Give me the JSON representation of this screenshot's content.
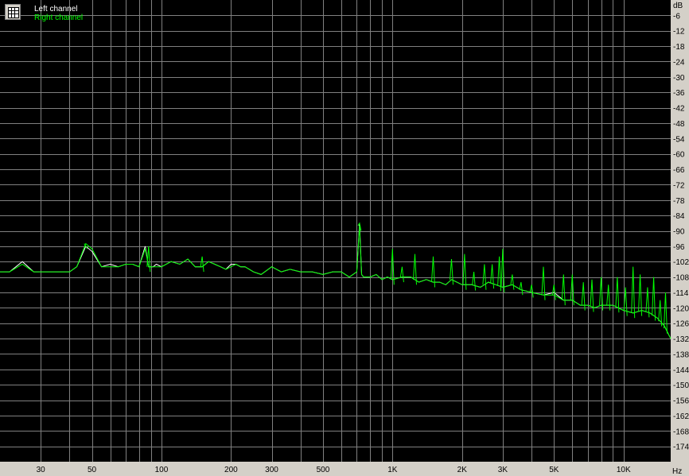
{
  "chart_data": {
    "type": "line",
    "title": "",
    "xlabel": "",
    "ylabel": "",
    "x_scale": "log",
    "x_unit": "Hz",
    "y_unit": "dB",
    "xlim": [
      20,
      16000
    ],
    "ylim": [
      -180,
      0
    ],
    "x_tick_labels": [
      {
        "v": 30,
        "label": "30"
      },
      {
        "v": 50,
        "label": "50"
      },
      {
        "v": 100,
        "label": "100"
      },
      {
        "v": 200,
        "label": "200"
      },
      {
        "v": 300,
        "label": "300"
      },
      {
        "v": 500,
        "label": "500"
      },
      {
        "v": 1000,
        "label": "1K"
      },
      {
        "v": 2000,
        "label": "2K"
      },
      {
        "v": 3000,
        "label": "3K"
      },
      {
        "v": 5000,
        "label": "5K"
      },
      {
        "v": 10000,
        "label": "10K"
      }
    ],
    "y_ticks": [
      -6,
      -12,
      -18,
      -24,
      -30,
      -36,
      -42,
      -48,
      -54,
      -60,
      -66,
      -72,
      -78,
      -84,
      -90,
      -96,
      -102,
      -108,
      -114,
      -120,
      -126,
      -132,
      -138,
      -144,
      -150,
      -156,
      -162,
      -168,
      -174
    ],
    "grid": true,
    "background": "#000000",
    "grid_color": "#808080",
    "legend_position": "top-left",
    "series": [
      {
        "name": "Left channel",
        "color": "#ffffff",
        "x": [
          20,
          22,
          25,
          28,
          30,
          35,
          40,
          43,
          47,
          50,
          55,
          60,
          65,
          70,
          75,
          80,
          85,
          88,
          92,
          95,
          100,
          110,
          120,
          130,
          140,
          150,
          160,
          170,
          180,
          190,
          200,
          210,
          220,
          230,
          240,
          250,
          270,
          300,
          330,
          360,
          400,
          450,
          500,
          550,
          600,
          650,
          700,
          720,
          735,
          750,
          800,
          850,
          900,
          950,
          1000,
          1100,
          1200,
          1300,
          1400,
          1500,
          1600,
          1700,
          1800,
          1900,
          2000,
          2200,
          2400,
          2600,
          2800,
          3000,
          3300,
          3600,
          4000,
          4500,
          5000,
          5500,
          6000,
          6500,
          7000,
          7500,
          8000,
          9000,
          10000,
          11000,
          12000,
          13000,
          14000,
          15000,
          16000
        ],
        "y": [
          -106,
          -106,
          -102,
          -106,
          -106,
          -106,
          -106,
          -104,
          -96,
          -98,
          -104,
          -103,
          -104,
          -103,
          -103,
          -104,
          -96,
          -104,
          -104,
          -103,
          -104,
          -102,
          -103,
          -101,
          -104,
          -104,
          -102,
          -103,
          -104,
          -105,
          -103,
          -103,
          -104,
          -104,
          -105,
          -106,
          -107,
          -104,
          -106,
          -105,
          -106,
          -106,
          -107,
          -106,
          -106,
          -108,
          -106,
          -87,
          -107,
          -108,
          -108,
          -107,
          -109,
          -108,
          -109,
          -108,
          -108,
          -110,
          -109,
          -110,
          -110,
          -111,
          -109,
          -110,
          -111,
          -111,
          -112,
          -110,
          -111,
          -112,
          -111,
          -113,
          -114,
          -115,
          -114,
          -117,
          -117,
          -119,
          -119,
          -120,
          -119,
          -119,
          -121,
          -122,
          -121,
          -122,
          -124,
          -127,
          -132
        ]
      },
      {
        "name": "Right channel",
        "color": "#00ff00",
        "x": [
          20,
          22,
          25,
          28,
          30,
          35,
          40,
          43,
          47,
          50,
          55,
          60,
          65,
          70,
          75,
          80,
          85,
          88,
          92,
          95,
          100,
          110,
          120,
          130,
          140,
          150,
          160,
          170,
          180,
          190,
          200,
          210,
          220,
          230,
          240,
          250,
          270,
          300,
          330,
          360,
          400,
          450,
          500,
          550,
          600,
          650,
          700,
          720,
          735,
          750,
          800,
          850,
          900,
          950,
          1000,
          1100,
          1200,
          1300,
          1400,
          1500,
          1600,
          1700,
          1800,
          1900,
          2000,
          2200,
          2400,
          2600,
          2800,
          3000,
          3300,
          3600,
          4000,
          4500,
          5000,
          5500,
          6000,
          6500,
          7000,
          7500,
          8000,
          9000,
          10000,
          11000,
          12000,
          13000,
          14000,
          15000,
          16000
        ],
        "y": [
          -106,
          -106,
          -103,
          -106,
          -106,
          -106,
          -106,
          -104,
          -95,
          -97,
          -104,
          -104,
          -104,
          -103,
          -103,
          -104,
          -97,
          -104,
          -104,
          -104,
          -104,
          -102,
          -103,
          -101,
          -104,
          -104,
          -102,
          -103,
          -104,
          -105,
          -104,
          -103,
          -104,
          -104,
          -105,
          -106,
          -107,
          -104,
          -106,
          -105,
          -106,
          -106,
          -107,
          -106,
          -106,
          -108,
          -106,
          -88,
          -107,
          -108,
          -108,
          -107,
          -109,
          -108,
          -109,
          -108,
          -108,
          -110,
          -109,
          -110,
          -110,
          -111,
          -109,
          -110,
          -111,
          -111,
          -112,
          -110,
          -111,
          -112,
          -111,
          -113,
          -114,
          -115,
          -115,
          -117,
          -117,
          -119,
          -119,
          -120,
          -119,
          -119,
          -121,
          -122,
          -121,
          -122,
          -124,
          -127,
          -132
        ]
      }
    ],
    "spikes": [
      {
        "x": 47,
        "y": -96
      },
      {
        "x": 88,
        "y": -96
      },
      {
        "x": 150,
        "y": -100
      },
      {
        "x": 720,
        "y": -87
      },
      {
        "x": 1000,
        "y": -97
      },
      {
        "x": 1100,
        "y": -104
      },
      {
        "x": 1250,
        "y": -99
      },
      {
        "x": 1500,
        "y": -100
      },
      {
        "x": 1800,
        "y": -101
      },
      {
        "x": 2050,
        "y": -99
      },
      {
        "x": 2250,
        "y": -106
      },
      {
        "x": 2500,
        "y": -103
      },
      {
        "x": 2700,
        "y": -103
      },
      {
        "x": 2900,
        "y": -100
      },
      {
        "x": 3000,
        "y": -97
      },
      {
        "x": 3300,
        "y": -107
      },
      {
        "x": 3600,
        "y": -110
      },
      {
        "x": 4000,
        "y": -111
      },
      {
        "x": 4500,
        "y": -104
      },
      {
        "x": 5000,
        "y": -111
      },
      {
        "x": 5500,
        "y": -107
      },
      {
        "x": 6000,
        "y": -107
      },
      {
        "x": 6700,
        "y": -110
      },
      {
        "x": 7300,
        "y": -109
      },
      {
        "x": 8000,
        "y": -108
      },
      {
        "x": 8600,
        "y": -111
      },
      {
        "x": 9400,
        "y": -108
      },
      {
        "x": 10200,
        "y": -112
      },
      {
        "x": 11000,
        "y": -104
      },
      {
        "x": 11800,
        "y": -107
      },
      {
        "x": 12700,
        "y": -112
      },
      {
        "x": 13500,
        "y": -108
      },
      {
        "x": 14400,
        "y": -117
      },
      {
        "x": 15200,
        "y": -114
      }
    ]
  },
  "legend": {
    "left": "Left channel",
    "right": "Right channel"
  },
  "axis_labels": {
    "y_unit": "dB",
    "x_unit": "Hz"
  }
}
